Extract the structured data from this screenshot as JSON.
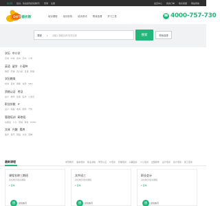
{
  "topbar": {
    "location": "【北京】",
    "welcome": "您好，欢迎来到德优教育！",
    "login": "登录",
    "register": "注册",
    "links": [
      "会员中心",
      "我的订单",
      "联系客服",
      "网站导航"
    ]
  },
  "header": {
    "logo_text": "DXTO",
    "logo_sub": "德优教育",
    "nav": [
      "培训课程",
      "培训机构",
      "培训资讯",
      "帮我选课",
      "学习工具"
    ],
    "phone": "4000-757-730"
  },
  "search": {
    "category": "课程",
    "placeholder": "请输入课程名称/机构名称",
    "button": "搜索",
    "other_button": "帮我选课"
  },
  "categories": [
    {
      "title": [
        "学历",
        "中小学"
      ],
      "subs": [
        "高考",
        "中考",
        "初中",
        "高中",
        "小学"
      ]
    },
    {
      "title": [
        "英语",
        "留学",
        "小语种"
      ],
      "subs": [
        "雅思",
        "托福",
        "四六级",
        "日语",
        "韩语"
      ]
    },
    {
      "title": [
        "学历教育"
      ],
      "subs": [
        "成考",
        "自考",
        "网教",
        "考研",
        "MBA"
      ]
    },
    {
      "title": [
        "资格认证",
        "考证"
      ],
      "subs": [
        "会计",
        "教师",
        "建造",
        "医学",
        "公务员"
      ]
    },
    {
      "title": [
        "职业技能",
        "IT"
      ],
      "subs": [
        "设计",
        "编程",
        "电商",
        "厨师",
        "汽修"
      ]
    },
    {
      "title": [
        "管理培训",
        "研修班"
      ],
      "subs": [
        "总裁班",
        "人力",
        "营销",
        "财务",
        "EMBA"
      ]
    },
    {
      "title": [
        "文体",
        "兴趣",
        "素养"
      ],
      "subs": [
        "美术",
        "音乐",
        "舞蹈",
        "书法",
        "围棋"
      ]
    }
  ],
  "recommend": {
    "title": "最新课程",
    "tabs": [
      "学历教育",
      "语言培训",
      "职业资格",
      "学历认证",
      "IT培训",
      "管理培训",
      "兴趣爱好",
      "少儿培训",
      "出国留学",
      "设计培训",
      "会计培训",
      "建工培训"
    ]
  },
  "cards": [
    {
      "title": "课程名称三期班",
      "sub": "德优教育培训课程",
      "tag": "¥ 咨询",
      "badge": "德",
      "brand": "德优教育"
    },
    {
      "title": "文件班三",
      "sub": "德优教育培训课程",
      "tag": "¥ 咨询",
      "badge": "德",
      "brand": "德优教育"
    },
    {
      "title": "职业会计",
      "sub": "德优教育培训课程",
      "tag": "¥ 咨询",
      "badge": "德",
      "brand": "德优教育"
    }
  ]
}
